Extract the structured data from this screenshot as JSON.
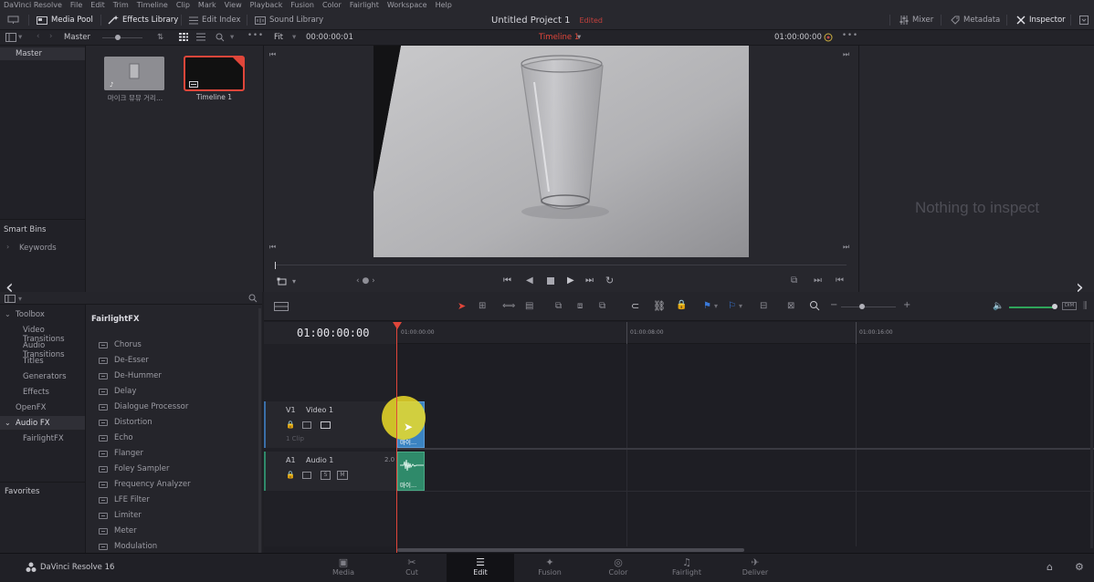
{
  "menu": [
    "DaVinci Resolve",
    "File",
    "Edit",
    "Trim",
    "Timeline",
    "Clip",
    "Mark",
    "View",
    "Playback",
    "Fusion",
    "Color",
    "Fairlight",
    "Workspace",
    "Help"
  ],
  "toolbar": {
    "media_pool": "Media Pool",
    "effects_library": "Effects Library",
    "edit_index": "Edit Index",
    "sound_library": "Sound Library",
    "project_title": "Untitled Project 1",
    "edited": "Edited",
    "mixer": "Mixer",
    "metadata": "Metadata",
    "inspector": "Inspector"
  },
  "media_pool": {
    "bin_label": "Master",
    "master_item": "Master",
    "clips": [
      {
        "name": "마이크 뮤뮤 거리..."
      },
      {
        "name": "Timeline 1"
      }
    ],
    "smart_bins": "Smart Bins",
    "keywords": "Keywords"
  },
  "viewer": {
    "fit": "Fit",
    "source_tc": "00:00:00:01",
    "timeline_name": "Timeline 1",
    "record_tc": "01:00:00:00"
  },
  "inspector": {
    "empty_text": "Nothing to inspect"
  },
  "effects": {
    "toolbox": "Toolbox",
    "tree": [
      "Video Transitions",
      "Audio Transitions",
      "Titles",
      "Generators",
      "Effects"
    ],
    "openfx": "OpenFX",
    "audiofx": "Audio FX",
    "fairlightfx": "FairlightFX",
    "favorites": "Favorites",
    "list_title": "FairlightFX",
    "items": [
      "Chorus",
      "De-Esser",
      "De-Hummer",
      "Delay",
      "Dialogue Processor",
      "Distortion",
      "Echo",
      "Flanger",
      "Foley Sampler",
      "Frequency Analyzer",
      "LFE Filter",
      "Limiter",
      "Meter",
      "Modulation"
    ]
  },
  "timeline": {
    "timecode": "01:00:00:00",
    "ruler": [
      "01:00:00:00",
      "01:00:08:00",
      "01:00:16:00"
    ],
    "video_track": {
      "id": "V1",
      "name": "Video 1",
      "clips_label": "1 Clip",
      "clip_text": "마이..."
    },
    "audio_track": {
      "id": "A1",
      "name": "Audio 1",
      "level": "2.0",
      "solo": "S",
      "mute": "M",
      "clip_text": "마이..."
    }
  },
  "bottom": {
    "brand": "DaVinci Resolve 16",
    "pages": [
      "Media",
      "Cut",
      "Edit",
      "Fusion",
      "Color",
      "Fairlight",
      "Deliver"
    ],
    "active_page": "Edit"
  },
  "colors": {
    "accent_red": "#e0463a",
    "clip_green": "#2f8a6a",
    "inspector_active": "#e4e4ea"
  }
}
